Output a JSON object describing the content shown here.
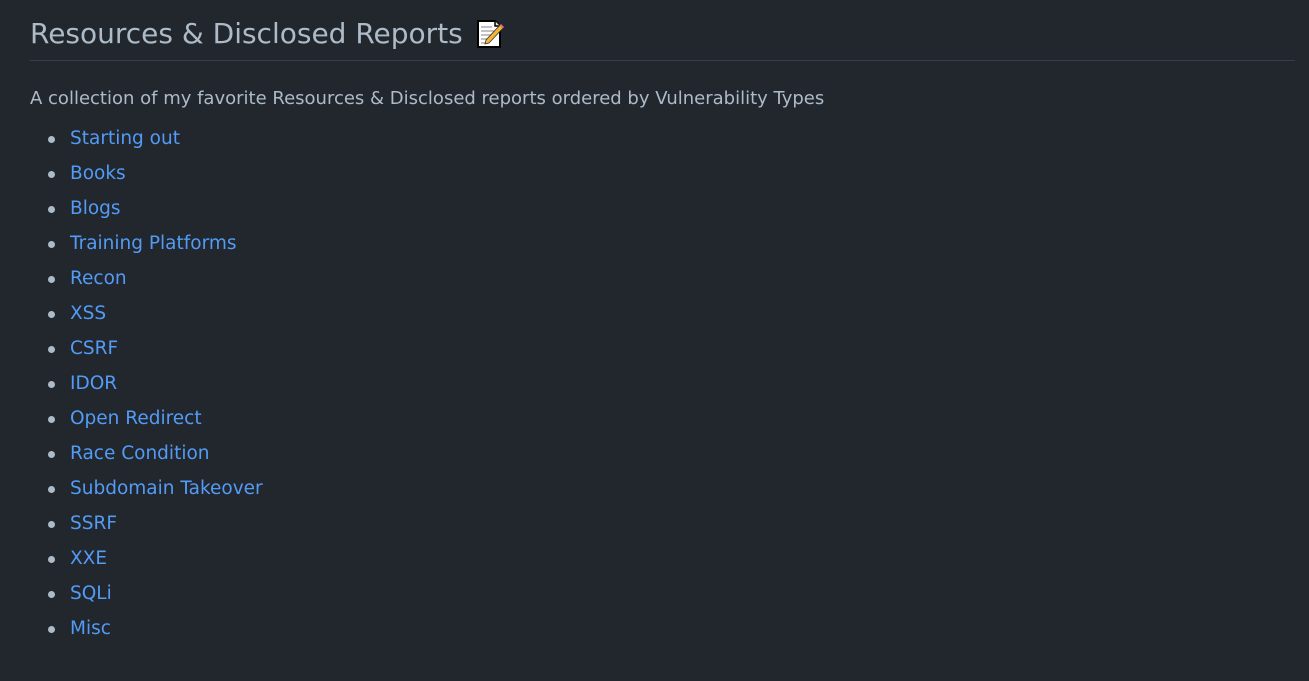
{
  "heading": {
    "title": "Resources & Disclosed Reports",
    "icon": "memo-icon"
  },
  "description": "A collection of my favorite Resources & Disclosed reports ordered by Vulnerability Types",
  "links": [
    {
      "label": "Starting out"
    },
    {
      "label": "Books"
    },
    {
      "label": "Blogs"
    },
    {
      "label": "Training Platforms"
    },
    {
      "label": "Recon"
    },
    {
      "label": "XSS"
    },
    {
      "label": "CSRF"
    },
    {
      "label": "IDOR"
    },
    {
      "label": "Open Redirect"
    },
    {
      "label": "Race Condition"
    },
    {
      "label": "Subdomain Takeover"
    },
    {
      "label": "SSRF"
    },
    {
      "label": "XXE"
    },
    {
      "label": "SQLi"
    },
    {
      "label": "Misc"
    }
  ],
  "colors": {
    "background": "#22272e",
    "text": "#adbac7",
    "link": "#539bf5",
    "divider": "#373e47"
  }
}
